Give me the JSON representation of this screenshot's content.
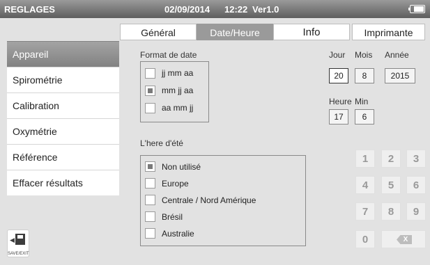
{
  "status_bar": {
    "title": "REGLAGES",
    "date": "02/09/2014",
    "time": "12:22",
    "version": "Ver1.0",
    "battery_icon": "battery-icon"
  },
  "tabs": [
    {
      "label": "Général",
      "active": false
    },
    {
      "label": "Date/Heure",
      "active": true
    },
    {
      "label": "Info",
      "active": false
    },
    {
      "label": "Imprimante",
      "active": false
    }
  ],
  "sidebar": {
    "items": [
      {
        "label": "Appareil",
        "active": true
      },
      {
        "label": "Spirométrie",
        "active": false
      },
      {
        "label": "Calibration",
        "active": false
      },
      {
        "label": "Oxymétrie",
        "active": false
      },
      {
        "label": "Référence",
        "active": false
      },
      {
        "label": "Effacer résultats",
        "active": false
      }
    ]
  },
  "date_format": {
    "title": "Format de date",
    "options": [
      {
        "label": "jj mm aa",
        "checked": false
      },
      {
        "label": "mm jj aa",
        "checked": true
      },
      {
        "label": "aa mm jj",
        "checked": false
      }
    ]
  },
  "summer_time": {
    "title": "L'here d'été",
    "options": [
      {
        "label": "Non utilisé",
        "checked": true
      },
      {
        "label": "Europe",
        "checked": false
      },
      {
        "label": "Centrale / Nord Amérique",
        "checked": false
      },
      {
        "label": "Brésil",
        "checked": false
      },
      {
        "label": "Australie",
        "checked": false
      }
    ]
  },
  "datetime": {
    "jour_label": "Jour",
    "jour": "20",
    "mois_label": "Mois",
    "mois": "8",
    "annee_label": "Année",
    "annee": "2015",
    "heure_label": "Heure",
    "heure": "17",
    "min_label": "Min",
    "min": "6"
  },
  "keypad": {
    "keys": [
      "1",
      "2",
      "3",
      "4",
      "5",
      "6",
      "7",
      "8",
      "9",
      "0"
    ],
    "backspace": "X"
  },
  "save_exit": {
    "label": "SAVE/EXIT",
    "icon": "save-exit-icon"
  },
  "colors": {
    "active_bg": "#9a9a9a",
    "topbar": "#6a6a6a"
  }
}
